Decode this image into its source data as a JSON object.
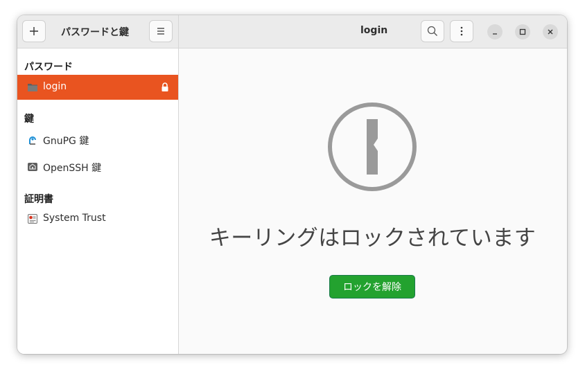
{
  "header": {
    "sidebar_title": "パスワードと鍵",
    "window_title": "login",
    "add_icon": "plus-icon",
    "menu_icon": "hamburger-icon",
    "search_icon": "search-icon",
    "more_icon": "vertical-dots-icon"
  },
  "sidebar": {
    "sections": [
      {
        "title": "パスワード",
        "items": [
          {
            "label": "login",
            "icon": "folder-icon",
            "selected": true,
            "badge_icon": "lock-icon"
          }
        ]
      },
      {
        "title": "鍵",
        "items": [
          {
            "label": "GnuPG 鍵",
            "icon": "gnupg-key-icon"
          },
          {
            "label": "OpenSSH 鍵",
            "icon": "ssh-key-icon"
          }
        ]
      },
      {
        "title": "証明書",
        "items": [
          {
            "label": "System Trust",
            "icon": "certificate-icon"
          }
        ]
      }
    ]
  },
  "main": {
    "status_icon": "keyhole-lock-icon",
    "message": "キーリングはロックされています",
    "unlock_label": "ロックを解除"
  },
  "colors": {
    "accent": "#e95420",
    "unlock_button": "#23a22f",
    "icon_gray": "#9a9a9a"
  }
}
